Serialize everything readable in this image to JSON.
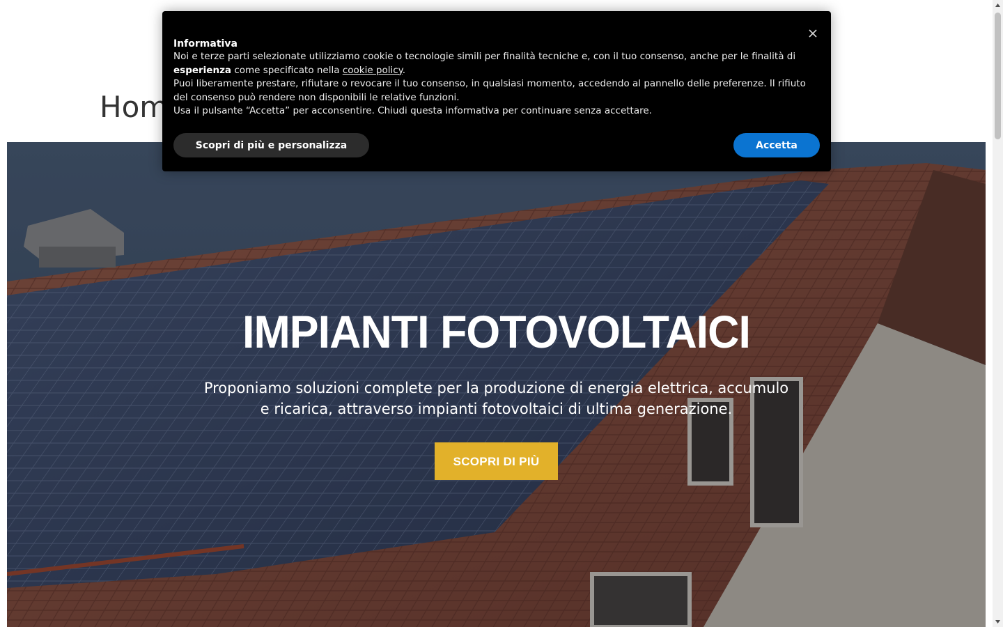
{
  "page": {
    "heading": "Hom"
  },
  "hero": {
    "title": "IMPIANTI FOTOVOLTAICI",
    "subtitle": "Proponiamo soluzioni complete per la produzione di energia elettrica, accumulo e ricarica, attraverso impianti fotovoltaici di ultima generazione.",
    "cta_label": "SCOPRI DI PIÙ",
    "cta_color": "#e2b12a"
  },
  "cookie_banner": {
    "title": "Informativa",
    "close_icon": "close-icon",
    "line1_pre": "Noi e terze parti selezionate utilizziamo cookie o tecnologie simili per finalità tecniche e, con il tuo consenso, anche per le finalità di ",
    "line1_bold": "esperienza",
    "line1_mid": " come specificato nella ",
    "line1_link": "cookie policy",
    "line1_post": ".",
    "line2": "Puoi liberamente prestare, rifiutare o revocare il tuo consenso, in qualsiasi momento, accedendo al pannello delle preferenze. Il rifiuto del consenso può rendere non disponibili le relative funzioni.",
    "line3": "Usa il pulsante “Accetta” per acconsentire. Chiudi questa informativa per continuare senza accettare.",
    "customize_label": "Scopri di più e personalizza",
    "accept_label": "Accetta",
    "accept_color": "#0b74d1"
  }
}
